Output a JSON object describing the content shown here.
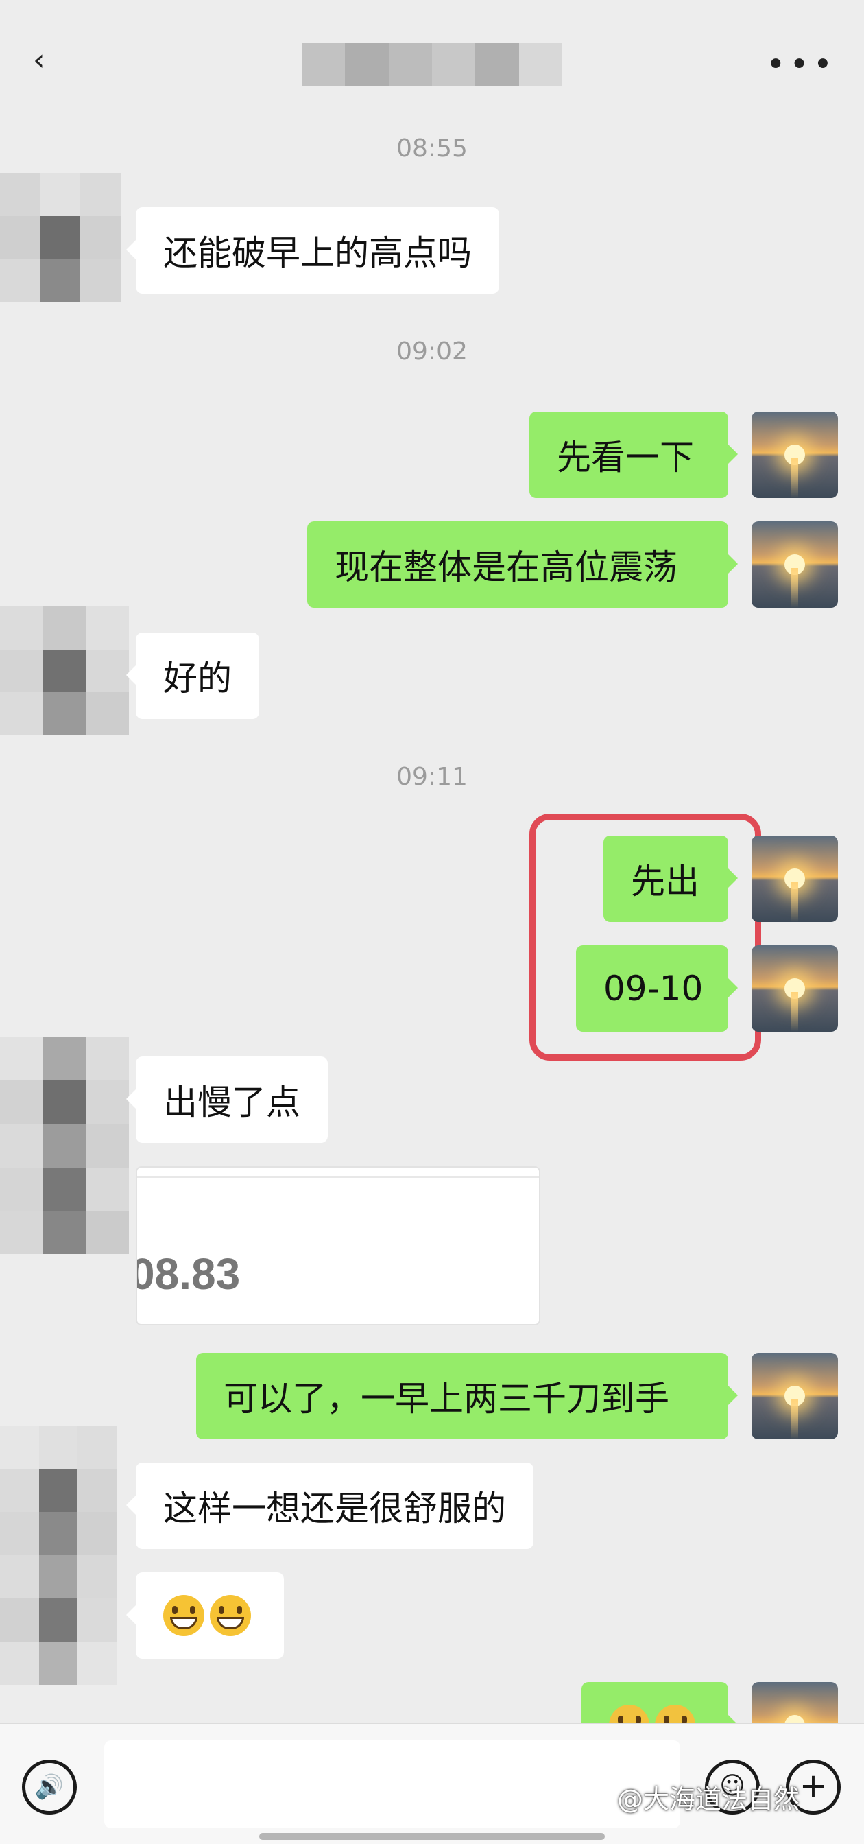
{
  "header": {
    "back_icon": "chevron-left-icon",
    "more_icon": "more-dots-icon",
    "more_label": "•••"
  },
  "messages": {
    "t1": "08:55",
    "m1": "还能破早上的高点吗",
    "t2": "09:02",
    "m2": "先看一下",
    "m3": "现在整体是在高位震荡",
    "m4": "好的",
    "t3": "09:11",
    "m5": "先出",
    "m6": "09-10",
    "m7": "出慢了点",
    "card_value": "08.83",
    "m8": "可以了，一早上两三千刀到手",
    "m9": "这样一想还是很舒服的"
  },
  "bottom": {
    "voice_label": "🔊",
    "emoji_label": "☺",
    "plus_label": "+"
  },
  "watermark": "@大海道法自然",
  "colors": {
    "background": "#ededed",
    "outgoing_bubble": "#95ec69",
    "incoming_bubble": "#ffffff",
    "highlight": "#e04a55"
  }
}
